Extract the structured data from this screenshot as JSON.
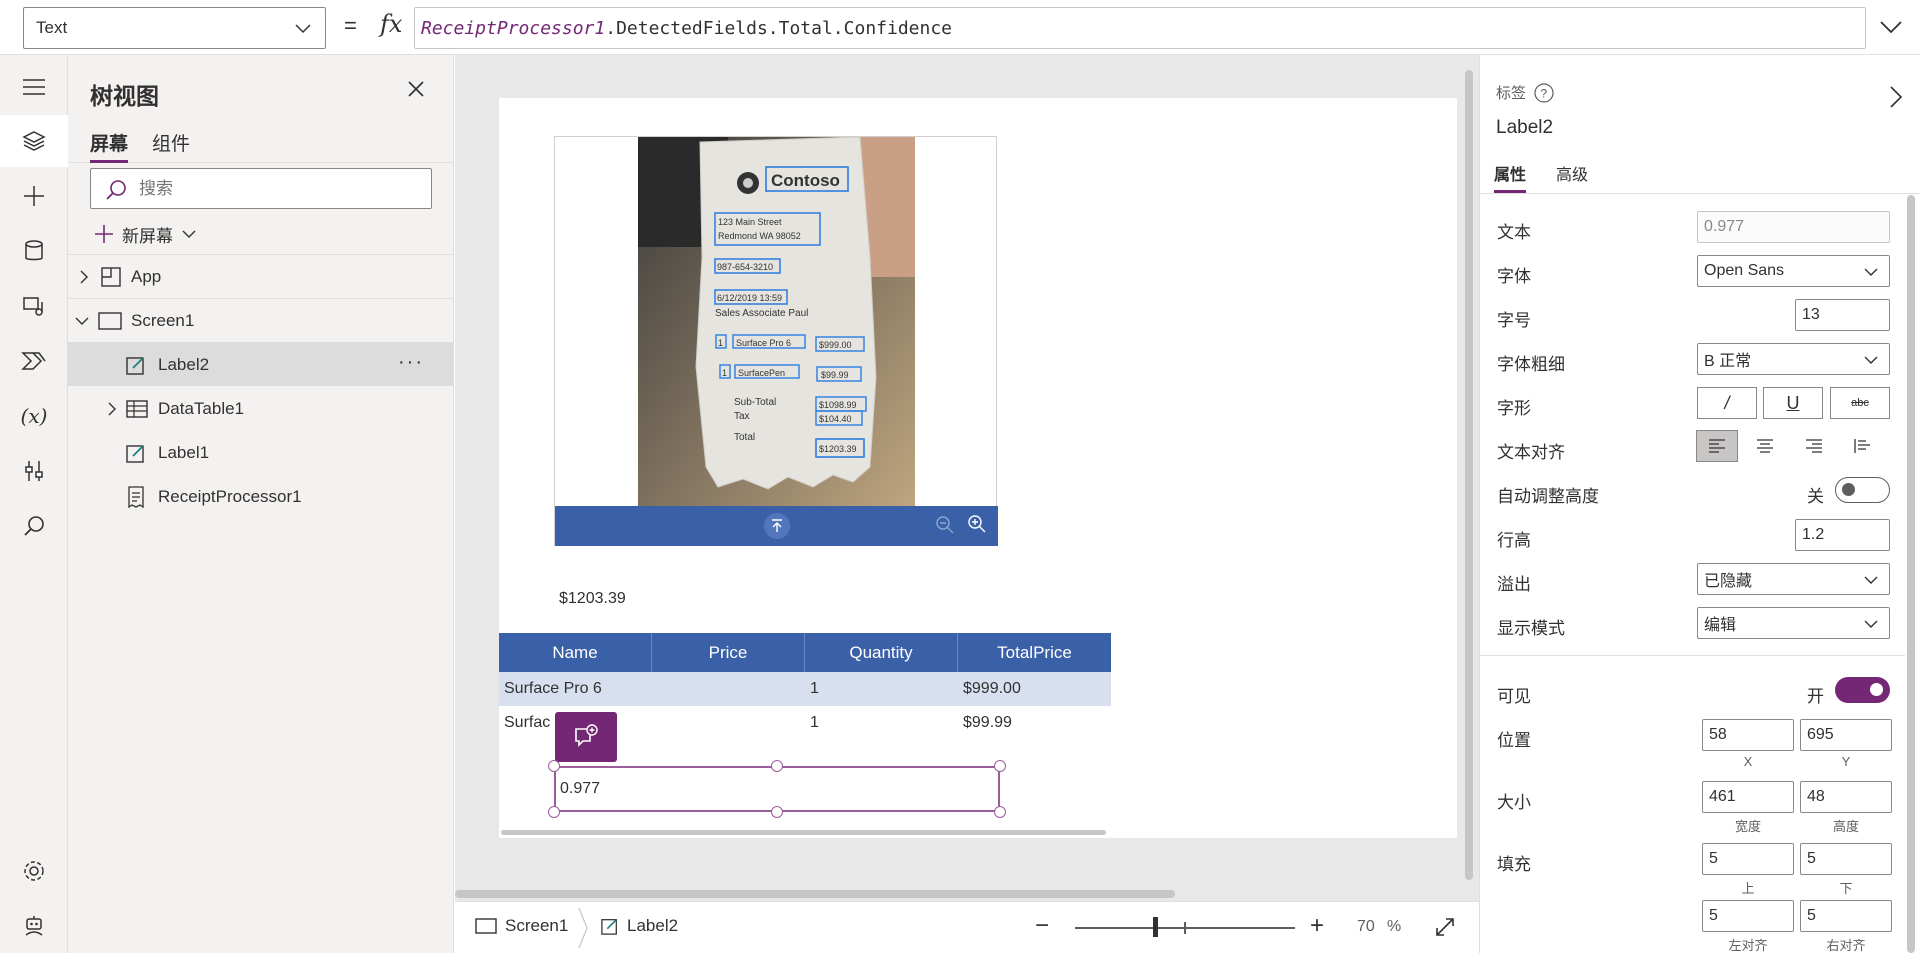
{
  "formula_bar": {
    "property": "Text",
    "equals": "=",
    "fx": "fx",
    "formula_object": "ReceiptProcessor1",
    "formula_rest": ".DetectedFields.Total.Confidence"
  },
  "tree": {
    "title": "树视图",
    "tabs": [
      "屏幕",
      "组件"
    ],
    "search_placeholder": "搜索",
    "new_screen": "新屏幕",
    "items": [
      {
        "label": "App"
      },
      {
        "label": "Screen1"
      },
      {
        "label": "Label2",
        "more": "···"
      },
      {
        "label": "DataTable1"
      },
      {
        "label": "Label1"
      },
      {
        "label": "ReceiptProcessor1"
      }
    ]
  },
  "canvas": {
    "receipt": {
      "brand": "Contoso",
      "addr1": "123 Main Street",
      "addr2": "Redmond WA 98052",
      "phone": "987-654-3210",
      "date": "6/12/2019 13:59",
      "associate": "Sales Associate Paul",
      "line1_qty": "1",
      "line1_name": "Surface Pro 6",
      "line1_price": "$999.00",
      "line2_qty": "1",
      "line2_name": "SurfacePen",
      "line2_price": "$99.99",
      "subtotal_label": "Sub-Total",
      "tax_label": "Tax",
      "subtotal_value": "$1098.99",
      "tax_value": "$104.40",
      "total_label": "Total",
      "total_value": "$1203.39"
    },
    "total_text": "$1203.39",
    "table": {
      "columns": [
        "Name",
        "Price",
        "Quantity",
        "TotalPrice"
      ],
      "rows": [
        [
          "Surface Pro 6",
          "",
          "1",
          "$999.00"
        ],
        [
          "Surfac",
          "",
          "1",
          "$99.99"
        ]
      ]
    },
    "label2_text": "0.977"
  },
  "statusbar": {
    "screen": "Screen1",
    "control": "Label2",
    "zoom_value": "70",
    "zoom_unit": "%"
  },
  "props": {
    "type": "标签",
    "name": "Label2",
    "tabs": [
      "属性",
      "高级"
    ],
    "text_label": "文本",
    "text_value": "0.977",
    "font_label": "字体",
    "font_value": "Open Sans",
    "size_label": "字号",
    "size_value": "13",
    "weight_label": "字体粗细",
    "weight_value": "B  正常",
    "style_label": "字形",
    "style_buttons": [
      "/",
      "U",
      "abc"
    ],
    "align_label": "文本对齐",
    "autoheight_label": "自动调整高度",
    "autoheight_state": "关",
    "lineheight_label": "行高",
    "lineheight_value": "1.2",
    "overflow_label": "溢出",
    "overflow_value": "已隐藏",
    "displaymode_label": "显示模式",
    "displaymode_value": "编辑",
    "visible_label": "可见",
    "visible_state": "开",
    "position_label": "位置",
    "x_value": "58",
    "y_value": "695",
    "x_label": "X",
    "y_label": "Y",
    "size2_label": "大小",
    "width_value": "461",
    "height_value": "48",
    "width_label": "宽度",
    "height_label": "高度",
    "padding_label": "填充",
    "pad_top": "5",
    "pad_bottom": "5",
    "pad_top_label": "上",
    "pad_bottom_label": "下",
    "pad_left": "5",
    "pad_right": "5",
    "pad_left_label": "左对齐",
    "pad_right_label": "右对齐"
  },
  "colors": {
    "accent": "#742774",
    "table_header": "#3a60a8",
    "table_alt_row": "#d8e0ef"
  }
}
